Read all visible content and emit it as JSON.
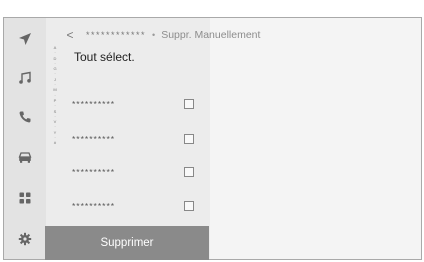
{
  "header": {
    "back_icon": "chevron-left-icon",
    "masked_name": "************",
    "separator": "•",
    "title": "Suppr. Manuellement"
  },
  "sidebar": {
    "items": [
      {
        "icon": "navigation-arrow-icon"
      },
      {
        "icon": "music-note-icon"
      },
      {
        "icon": "phone-icon",
        "active": true
      },
      {
        "icon": "car-icon"
      },
      {
        "icon": "apps-grid-icon"
      },
      {
        "icon": "gear-icon"
      }
    ]
  },
  "index": {
    "letters": [
      "A",
      "D",
      "G",
      "J",
      "M",
      "P",
      "S",
      "V",
      "Y",
      "#"
    ]
  },
  "list": {
    "select_all_label": "Tout sélect.",
    "items": [
      {
        "name": "**********",
        "checked": false
      },
      {
        "name": "**********",
        "checked": false
      },
      {
        "name": "**********",
        "checked": false
      },
      {
        "name": "**********",
        "checked": false
      }
    ]
  },
  "footer": {
    "delete_label": "Supprimer"
  }
}
